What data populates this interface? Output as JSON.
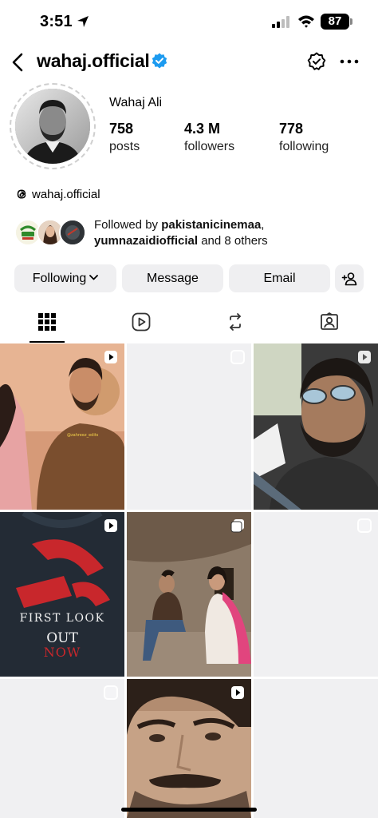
{
  "status_bar": {
    "time": "3:51",
    "battery": "87"
  },
  "header": {
    "username": "wahaj.official",
    "verified": true
  },
  "profile": {
    "display_name": "Wahaj Ali",
    "stats": [
      {
        "value": "758",
        "label": "posts"
      },
      {
        "value": "4.3 M",
        "label": "followers"
      },
      {
        "value": "778",
        "label": "following"
      }
    ],
    "threads_handle": "wahaj.official",
    "followed_by": {
      "prefix": "Followed by ",
      "user1": "pakistanicinemaa",
      "sep": ",",
      "user2": "yumnazaidiofficial",
      "suffix": " and 8 others"
    }
  },
  "buttons": {
    "following": "Following",
    "message": "Message",
    "email": "Email"
  },
  "tabs": [
    "grid-icon",
    "reels-icon",
    "reposts-icon",
    "tagged-icon"
  ],
  "grid": {
    "post4_lines": [
      "FIRST LOOK",
      "OUT",
      "NOW"
    ],
    "post1_watermark": "@zahreez_edits"
  },
  "colors": {
    "verified": "#1d9bf0",
    "button_bg": "#efeff1",
    "poster_red": "#c8272c"
  }
}
